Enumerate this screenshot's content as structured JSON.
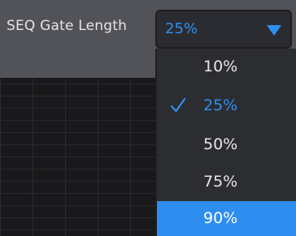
{
  "parameter": {
    "label": "SEQ Gate Length"
  },
  "select": {
    "value": "25%",
    "arrow_icon": "triangle-down-icon"
  },
  "options": [
    {
      "label": "10%",
      "selected": false,
      "highlighted": false
    },
    {
      "label": "25%",
      "selected": true,
      "highlighted": false
    },
    {
      "label": "50%",
      "selected": false,
      "highlighted": false
    },
    {
      "label": "75%",
      "selected": false,
      "highlighted": false
    },
    {
      "label": "90%",
      "selected": false,
      "highlighted": true
    }
  ],
  "colors": {
    "accent": "#2f8fef",
    "highlight": "#2e8ef0",
    "header": "#525358",
    "menu_background": "#2c2d31"
  }
}
